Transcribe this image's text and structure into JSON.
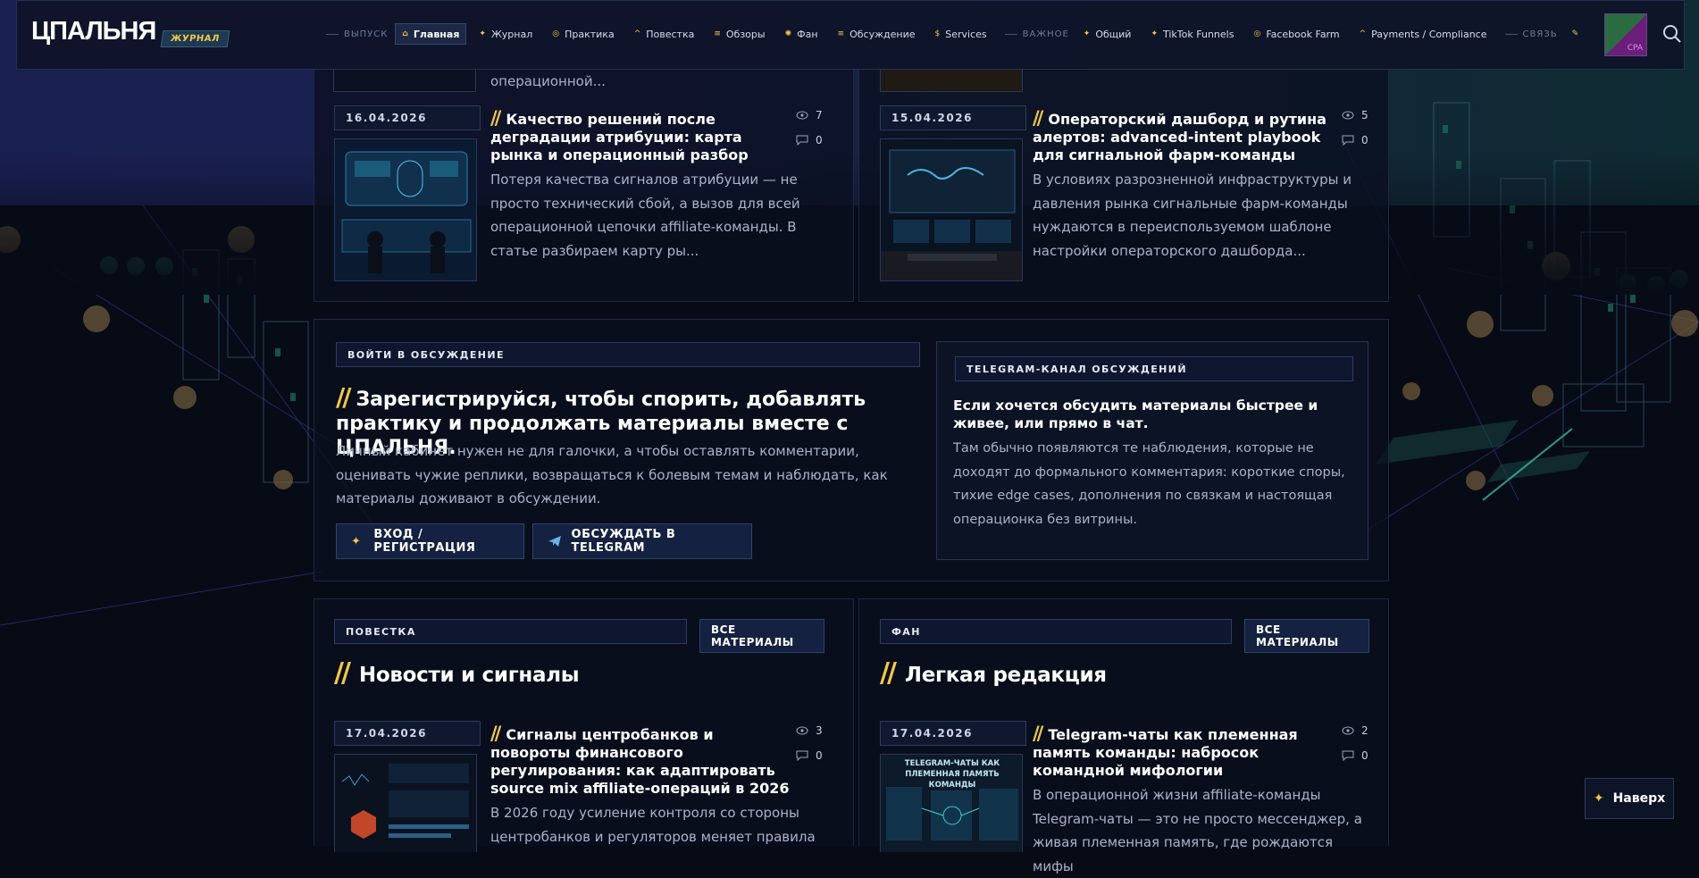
{
  "header": {
    "logo": "ЦПАЛЬНЯ",
    "logo_badge": "ЖУРНАЛ",
    "sep_issue": "ВЫПУСК",
    "sep_important": "ВАЖНОЕ",
    "sep_contact": "СВЯЗЬ",
    "nav": [
      {
        "label": "Главная",
        "icon": "home-icon"
      },
      {
        "label": "Журнал",
        "icon": "star-icon"
      },
      {
        "label": "Практика",
        "icon": "target-icon"
      },
      {
        "label": "Повестка",
        "icon": "caret-icon"
      },
      {
        "label": "Обзоры",
        "icon": "list-icon"
      },
      {
        "label": "Фан",
        "icon": "sun-icon"
      },
      {
        "label": "Обсуждение",
        "icon": "list-icon"
      },
      {
        "label": "Services",
        "icon": "dollar-icon"
      },
      {
        "label": "Общий",
        "icon": "star-icon"
      },
      {
        "label": "TikTok Funnels",
        "icon": "star-icon"
      },
      {
        "label": "Facebook Farm",
        "icon": "target-icon"
      },
      {
        "label": "Payments / Compliance",
        "icon": "caret-icon"
      }
    ],
    "avatar_text": "CPA"
  },
  "top_fragment": {
    "left_text": "операционной..."
  },
  "articles_top": [
    {
      "date": "16.04.2026",
      "title": "Качество решений после деградации атрибуции: карта рынка и операционный разбор",
      "excerpt": "Потеря качества сигналов атрибуции — не просто технический сбой, а вызов для всей операционной цепочки affiliate-команды. В статье разбираем карту ры...",
      "views": "7",
      "comments": "0"
    },
    {
      "date": "15.04.2026",
      "title": "Операторский дашборд и рутина алертов: advanced-intent playbook для сигнальной фарм-команды",
      "excerpt": "В условиях разрозненной инфраструктуры и давления рынка сигнальные фарм-команды нуждаются в переиспользуемом шаблоне настройки операторского дашборда...",
      "views": "5",
      "comments": "0"
    }
  ],
  "discussion": {
    "label": "ВОЙТИ В ОБСУЖДЕНИЕ",
    "title": "Зарегистрируйся, чтобы спорить, добавлять практику и продолжать материалы вместе с ЦПАЛЬНЯ.",
    "text": "Личный кабинет нужен не для галочки, а чтобы оставлять комментарии, оценивать чужие реплики, возвращаться к болевым темам и наблюдать, как материалы доживают в обсуждении.",
    "login_button": "ВХОД / РЕГИСТРАЦИЯ",
    "telegram_button": "ОБСУЖДАТЬ В TELEGRAM"
  },
  "telegram": {
    "label": "TELEGRAM-КАНАЛ ОБСУЖДЕНИЙ",
    "title": "Если хочется обсудить материалы быстрее и живее, или прямо в чат.",
    "text": "Там обычно появляются те наблюдения, которые не доходят до формального комментария: короткие споры, тихие edge cases, дополнения по связкам и настоящая операционка без витрины."
  },
  "sections": [
    {
      "label": "ПОВЕСТКА",
      "all_button": "ВСЕ МАТЕРИАЛЫ",
      "title": "Новости и сигналы",
      "article": {
        "date": "17.04.2026",
        "title": "Сигналы центробанков и повороты финансового регулирования: как адаптировать source mix affiliate-операций в 2026",
        "excerpt": "В 2026 году усиление контроля со стороны центробанков и регуляторов меняет правила",
        "views": "3",
        "comments": "0"
      }
    },
    {
      "label": "ФАН",
      "all_button": "ВСЕ МАТЕРИАЛЫ",
      "title": "Легкая редакция",
      "article": {
        "date": "17.04.2026",
        "title": "Telegram-чаты как племенная память команды: набросок командной мифологии",
        "excerpt": "В операционной жизни affiliate-команды Telegram-чаты — это не просто мессенджер, а живая племенная память, где рождаются мифы",
        "views": "2",
        "comments": "0",
        "thumb_caption": "TELEGRAM-ЧАТЫ КАК ПЛЕМЕННАЯ ПАМЯТЬ КОМАНДЫ"
      }
    }
  ],
  "back_to_top": "Наверх",
  "colors": {
    "accent": "#f3c94a",
    "background": "#070b16",
    "panel": "#0a1020"
  }
}
